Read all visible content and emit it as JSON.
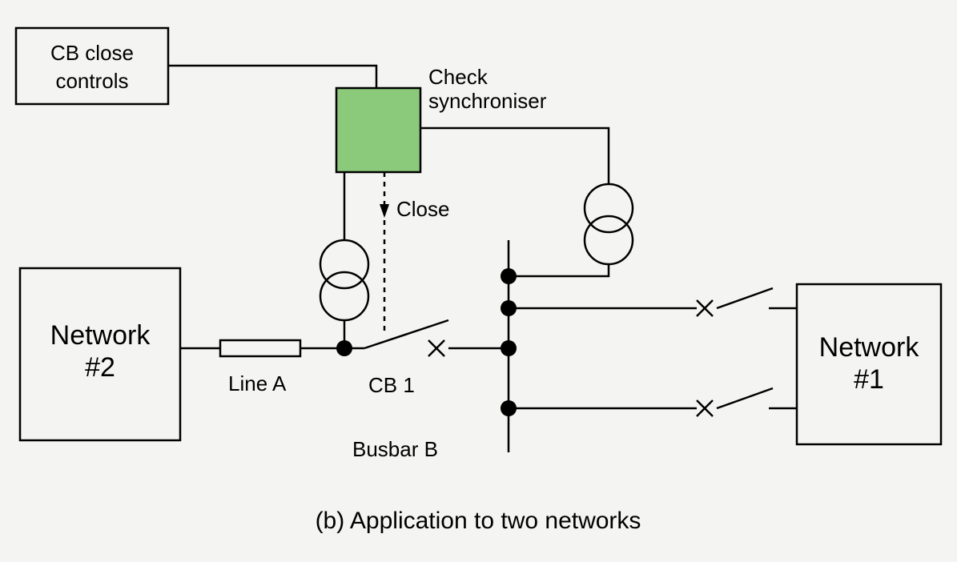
{
  "labels": {
    "cb_close_controls_l1": "CB close",
    "cb_close_controls_l2": "controls",
    "check_sync_l1": "Check",
    "check_sync_l2": "synchroniser",
    "close": "Close",
    "network2_l1": "Network",
    "network2_l2": "#2",
    "network1_l1": "Network",
    "network1_l2": "#1",
    "line_a": "Line A",
    "cb1": "CB 1",
    "busbar_b": "Busbar B",
    "caption": "(b) Application to two networks"
  },
  "diagram": {
    "figure_id": "b",
    "title": "Application to two networks",
    "components": [
      {
        "id": "network2",
        "type": "external-network",
        "label": "Network #2"
      },
      {
        "id": "network1",
        "type": "external-network",
        "label": "Network #1"
      },
      {
        "id": "lineA",
        "type": "transmission-line",
        "label": "Line A",
        "between": [
          "network2",
          "cb1"
        ]
      },
      {
        "id": "cb1",
        "type": "circuit-breaker",
        "label": "CB 1",
        "state": "open",
        "close_signal_from": "check_sync"
      },
      {
        "id": "busbarB",
        "type": "busbar",
        "label": "Busbar B"
      },
      {
        "id": "brk_top",
        "type": "circuit-breaker",
        "state": "open",
        "between": [
          "busbarB",
          "network1"
        ]
      },
      {
        "id": "brk_bot",
        "type": "circuit-breaker",
        "state": "open",
        "between": [
          "busbarB",
          "network1"
        ]
      },
      {
        "id": "vt_line",
        "type": "voltage-transformer",
        "side": "line",
        "feeds": "check_sync"
      },
      {
        "id": "vt_bus",
        "type": "voltage-transformer",
        "side": "bus",
        "feeds": "check_sync"
      },
      {
        "id": "check_sync",
        "type": "check-synchroniser-relay",
        "label": "Check synchroniser",
        "inputs": [
          "vt_line",
          "vt_bus",
          "cb_close_controls"
        ],
        "output_close_to": "cb1"
      },
      {
        "id": "cb_close_controls",
        "type": "operator-control",
        "label": "CB close controls"
      }
    ],
    "connections": [
      [
        "network2",
        "lineA"
      ],
      [
        "lineA",
        "cb1"
      ],
      [
        "cb1",
        "busbarB"
      ],
      [
        "busbarB",
        "brk_top"
      ],
      [
        "brk_top",
        "network1"
      ],
      [
        "busbarB",
        "brk_bot"
      ],
      [
        "brk_bot",
        "network1"
      ],
      [
        "vt_line",
        "check_sync"
      ],
      [
        "vt_bus",
        "check_sync"
      ],
      [
        "cb_close_controls",
        "check_sync"
      ],
      [
        "check_sync",
        "cb1"
      ]
    ]
  }
}
